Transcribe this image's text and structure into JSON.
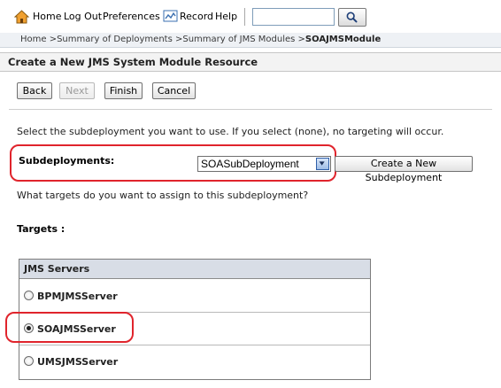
{
  "toolbar": {
    "home_label": "Home",
    "logout_label": "Log Out",
    "preferences_label": "Preferences",
    "record_label": "Record",
    "help_label": "Help",
    "search_value": "",
    "icons": [
      "home-icon",
      "record-icon",
      "search-icon"
    ]
  },
  "breadcrumb": {
    "path": "Home >Summary of Deployments >Summary of JMS Modules >",
    "current": "SOAJMSModule"
  },
  "page": {
    "title": "Create a New JMS System Module Resource"
  },
  "wizard": {
    "back_label": "Back",
    "next_label": "Next",
    "finish_label": "Finish",
    "cancel_label": "Cancel",
    "next_disabled": true
  },
  "subdeployment": {
    "instruction": "Select the subdeployment you want to use. If you select (none), no targeting will occur.",
    "label": "Subdeployments:",
    "selected": "SOASubDeployment",
    "create_label": "Create a New Subdeployment"
  },
  "targets": {
    "question": "What targets do you want to assign to this subdeployment?",
    "label": "Targets :",
    "table": {
      "header": "JMS Servers",
      "rows": [
        {
          "label": "BPMJMSServer",
          "checked": false
        },
        {
          "label": "SOAJMSServer",
          "checked": true
        },
        {
          "label": "UMSJMSServer",
          "checked": false
        }
      ]
    }
  },
  "colors": {
    "highlight": "#e0242c",
    "table_header": "#d8dde6",
    "heading_bar": "#f3f3f3",
    "home_icon": "#f0a030",
    "record_icon": "#3a6fb0"
  }
}
